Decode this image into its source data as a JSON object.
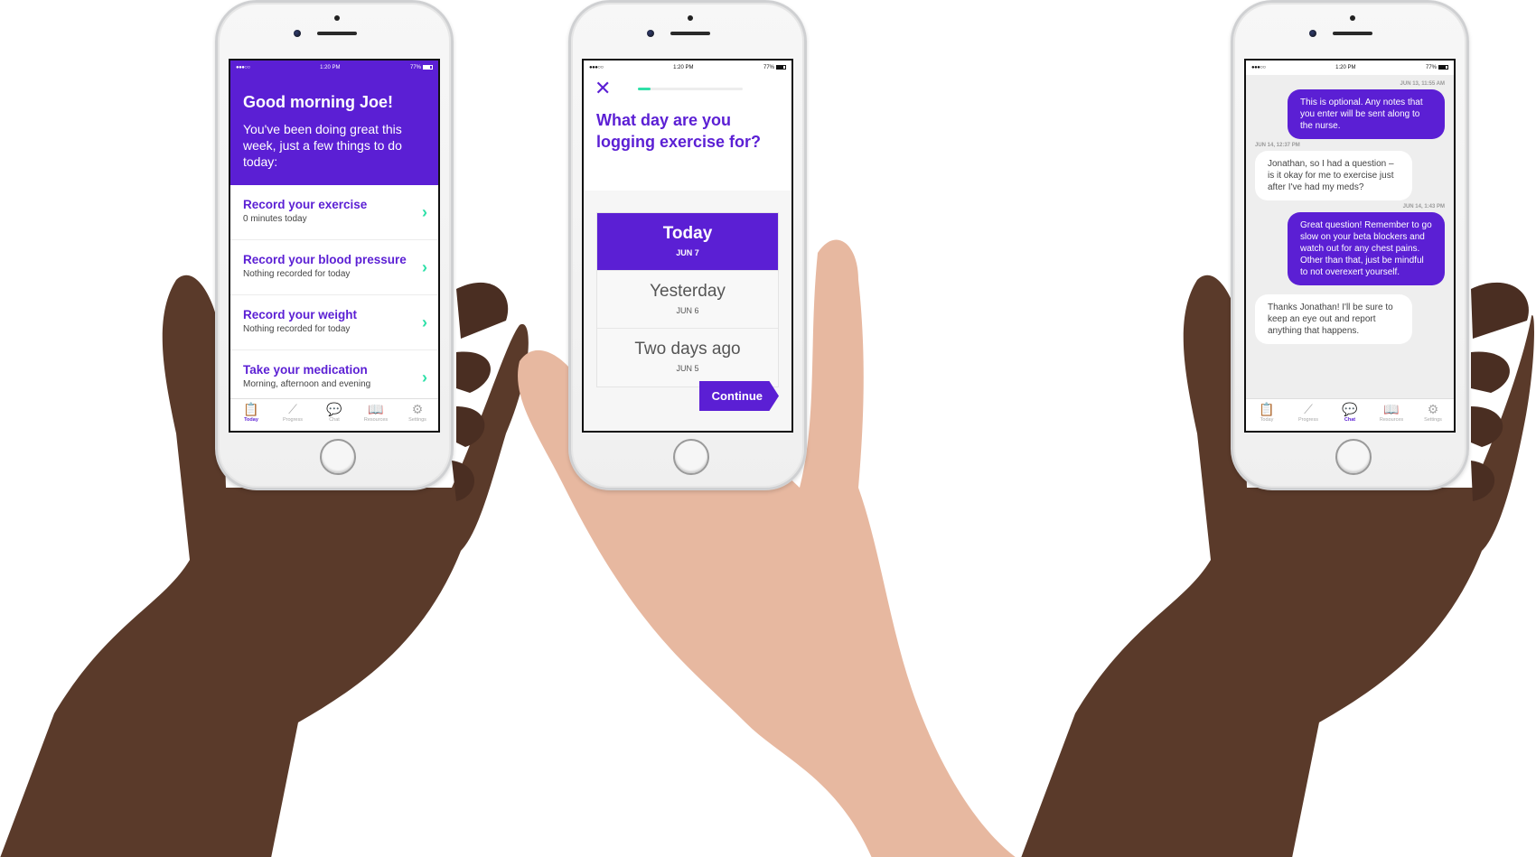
{
  "colors": {
    "brand_purple": "#5b1fd4",
    "accent_green": "#2fe0a8",
    "chat_background": "#eeeeee"
  },
  "status_bar": {
    "signal": "●●●○○",
    "time": "1:20 PM",
    "battery": "77%"
  },
  "today_screen": {
    "greeting": "Good morning Joe!",
    "subtitle": "You've been doing great this week, just a few things to do today:",
    "tasks": [
      {
        "title": "Record your exercise",
        "subtitle": "0 minutes today"
      },
      {
        "title": "Record your blood pressure",
        "subtitle": "Nothing recorded for today"
      },
      {
        "title": "Record your weight",
        "subtitle": "Nothing recorded for today"
      },
      {
        "title": "Take your medication",
        "subtitle": "Morning, afternoon and evening"
      }
    ],
    "active_tab": "Today"
  },
  "tabs": [
    {
      "label": "Today",
      "icon": "clipboard-icon"
    },
    {
      "label": "Progress",
      "icon": "chart-line-icon"
    },
    {
      "label": "Chat",
      "icon": "chat-bubbles-icon"
    },
    {
      "label": "Resources",
      "icon": "book-icon"
    },
    {
      "label": "Settings",
      "icon": "gear-icon"
    }
  ],
  "log_screen": {
    "question": "What day are you logging exercise for?",
    "progress_fraction": 0.12,
    "options": [
      {
        "label": "Today",
        "date": "JUN 7",
        "selected": true
      },
      {
        "label": "Yesterday",
        "date": "JUN 6",
        "selected": false
      },
      {
        "label": "Two days ago",
        "date": "JUN 5",
        "selected": false
      }
    ],
    "continue_label": "Continue"
  },
  "chat_screen": {
    "messages": [
      {
        "timestamp": "JUN 13, 11:55 AM",
        "direction": "out",
        "text": "This is optional. Any notes that you enter will be sent along to the nurse."
      },
      {
        "timestamp": "JUN 14, 12:37 PM",
        "direction": "in",
        "text": "Jonathan, so I had a question – is it okay for me to exercise just after I've had my meds?"
      },
      {
        "timestamp": "JUN 14, 1:43 PM",
        "direction": "out",
        "text": "Great question! Remember to go slow on your beta blockers and watch out for any chest pains. Other than that, just be mindful to not overexert yourself."
      },
      {
        "timestamp": "",
        "direction": "in",
        "text": "Thanks Jonathan! I'll be sure to keep an eye out and report anything that happens."
      }
    ],
    "active_tab": "Chat"
  }
}
